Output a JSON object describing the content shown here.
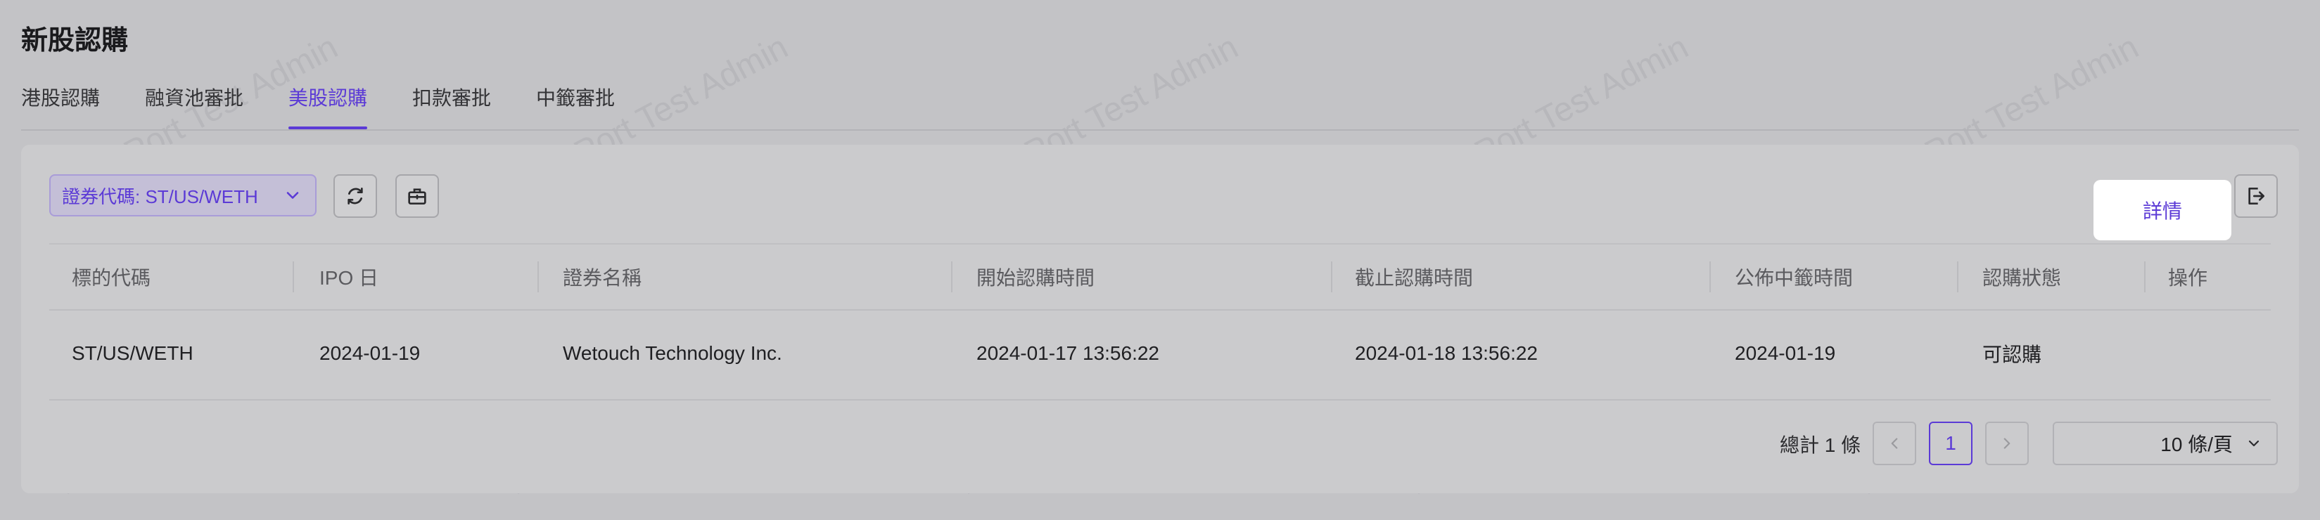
{
  "page": {
    "title": "新股認購"
  },
  "tabs": [
    {
      "label": "港股認購"
    },
    {
      "label": "融資池審批"
    },
    {
      "label": "美股認購"
    },
    {
      "label": "扣款審批"
    },
    {
      "label": "中籤審批"
    }
  ],
  "toolbar": {
    "filter_label": "證券代碼: ST/US/WETH",
    "icons": [
      "refresh-icon",
      "toolbox-icon",
      "export-icon"
    ]
  },
  "table": {
    "headers": [
      "標的代碼",
      "IPO 日",
      "證券名稱",
      "開始認購時間",
      "截止認購時間",
      "公佈中籤時間",
      "認購狀態",
      "操作"
    ],
    "rows": [
      {
        "code": "ST/US/WETH",
        "ipo_date": "2024-01-19",
        "name": "Wetouch Technology Inc.",
        "start_time": "2024-01-17 13:56:22",
        "end_time": "2024-01-18 13:56:22",
        "announce_date": "2024-01-19",
        "status": "可認購",
        "action": "詳情"
      }
    ]
  },
  "pagination": {
    "total_text": "總計 1 條",
    "current_page": "1",
    "page_size": "10 條/頁"
  },
  "watermark": {
    "text": "LongPort Test Admin"
  },
  "colors": {
    "accent": "#5b3ad6",
    "background": "#c3c3c6",
    "card": "#cbcbcd"
  }
}
